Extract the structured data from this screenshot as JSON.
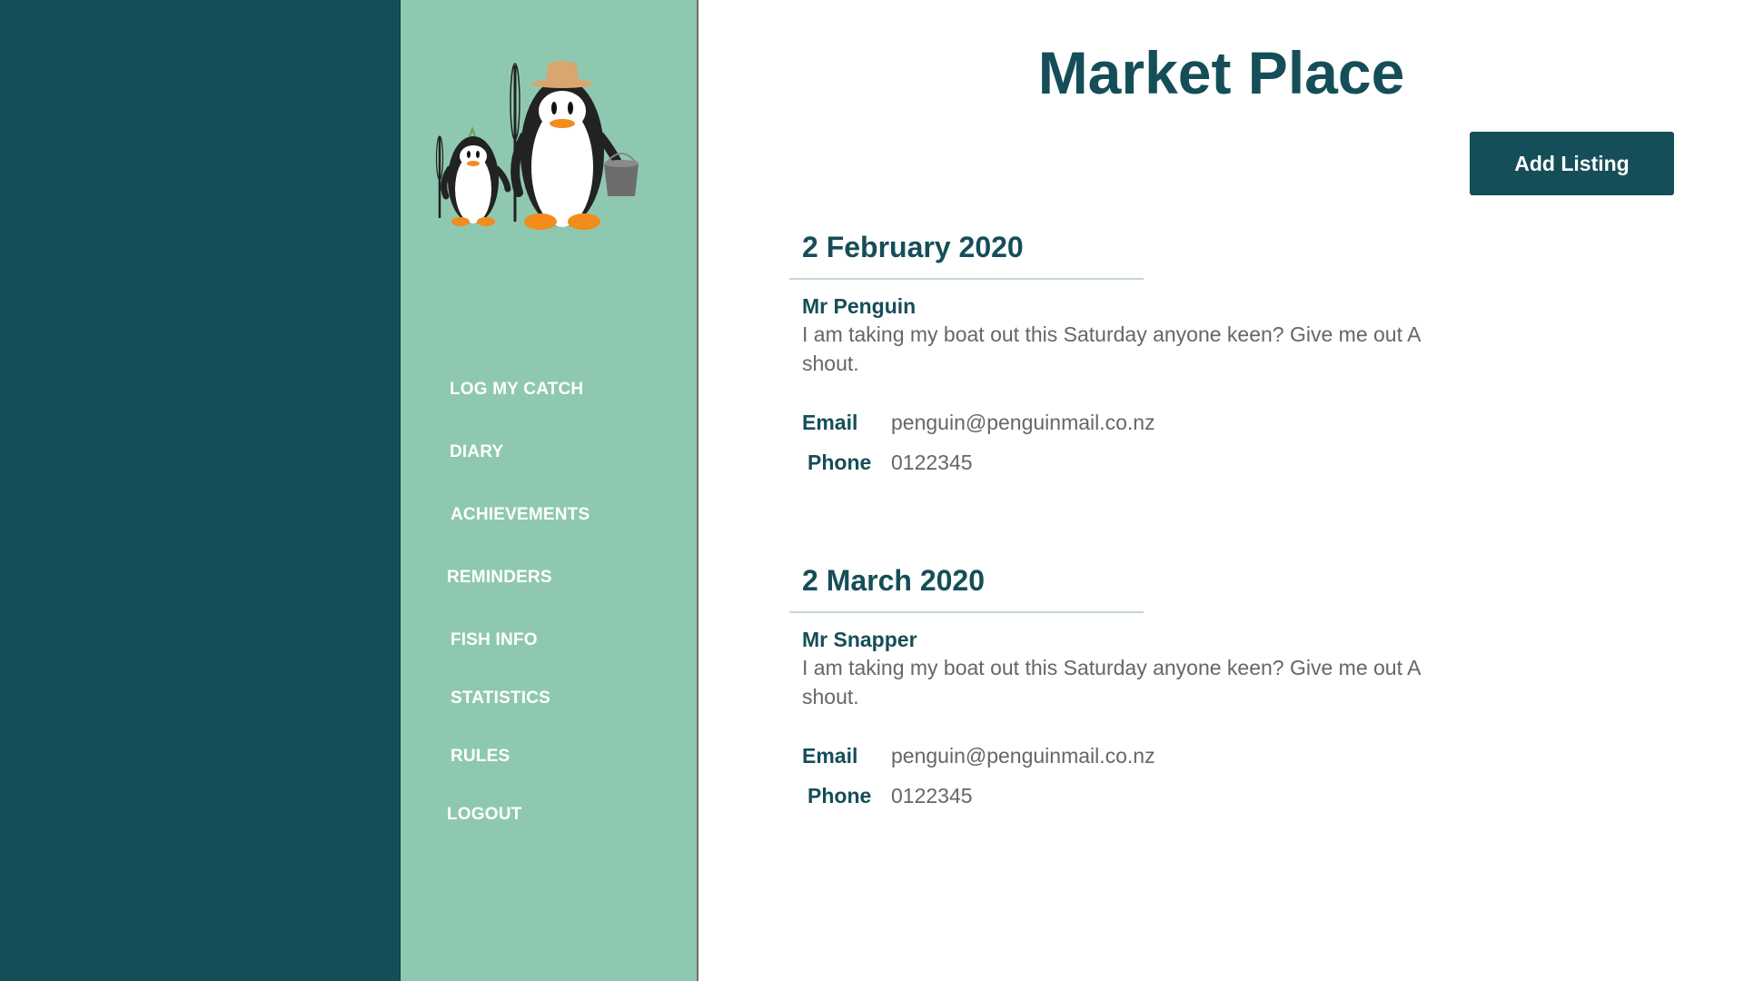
{
  "sidebar": {
    "logo": "penguins-fishing-logo",
    "nav": [
      {
        "label": "LOG MY CATCH",
        "icon": ""
      },
      {
        "label": "DIARY",
        "icon": ""
      },
      {
        "label": "ACHIEVEMENTS",
        "icon": ""
      },
      {
        "label": "REMINDERS",
        "icon": ""
      },
      {
        "label": "FISH INFO",
        "icon": ""
      },
      {
        "label": "STATISTICS",
        "icon": ""
      },
      {
        "label": "RULES",
        "icon": ""
      },
      {
        "label": "LOGOUT",
        "icon": ""
      }
    ]
  },
  "main": {
    "title": "Market Place",
    "add_button": "Add Listing",
    "listings": [
      {
        "date": "2 February 2020",
        "author": "Mr Penguin",
        "message": "I am taking my boat out this Saturday anyone keen? Give me out A shout.",
        "email_label": "Email",
        "email": "penguin@penguinmail.co.nz",
        "phone_label": "Phone",
        "phone": "0122345"
      },
      {
        "date": "2 March 2020",
        "author": "Mr Snapper",
        "message": "I am taking my boat out this Saturday anyone keen? Give me out A shout.",
        "email_label": "Email",
        "email": "penguin@penguinmail.co.nz",
        "phone_label": "Phone",
        "phone": "0122345"
      }
    ]
  },
  "colors": {
    "dark_panel": "#154e58",
    "sidebar": "#8fc8b1",
    "accent": "#154e58",
    "body_text": "#666666"
  }
}
